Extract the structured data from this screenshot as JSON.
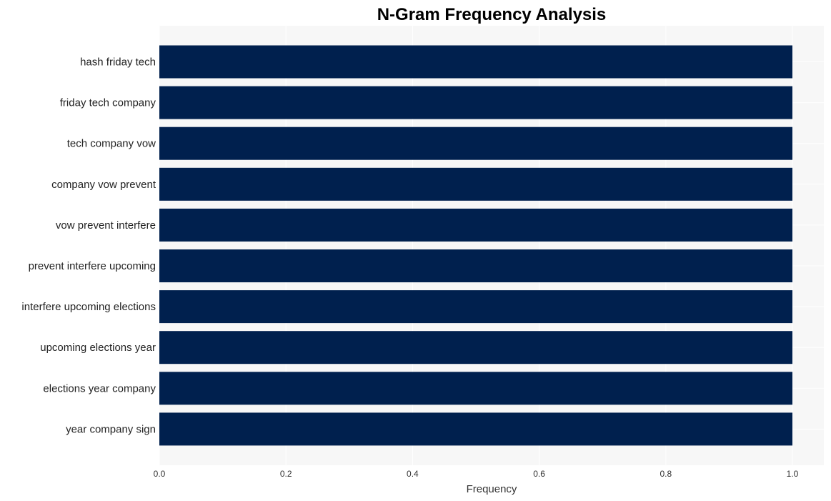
{
  "chart_data": {
    "type": "bar",
    "orientation": "horizontal",
    "title": "N-Gram Frequency Analysis",
    "xlabel": "Frequency",
    "ylabel": "",
    "categories": [
      "hash friday tech",
      "friday tech company",
      "tech company vow",
      "company vow prevent",
      "vow prevent interfere",
      "prevent interfere upcoming",
      "interfere upcoming elections",
      "upcoming elections year",
      "elections year company",
      "year company sign"
    ],
    "values": [
      1,
      1,
      1,
      1,
      1,
      1,
      1,
      1,
      1,
      1
    ],
    "xlim": [
      0,
      1.05
    ],
    "xticks": [
      "0.0",
      "0.2",
      "0.4",
      "0.6",
      "0.8",
      "1.0"
    ],
    "grid": true,
    "legend": "none",
    "colors": {
      "bar": "#00204e",
      "plot_background": "#f7f7f7",
      "grid": "#ffffff"
    }
  }
}
